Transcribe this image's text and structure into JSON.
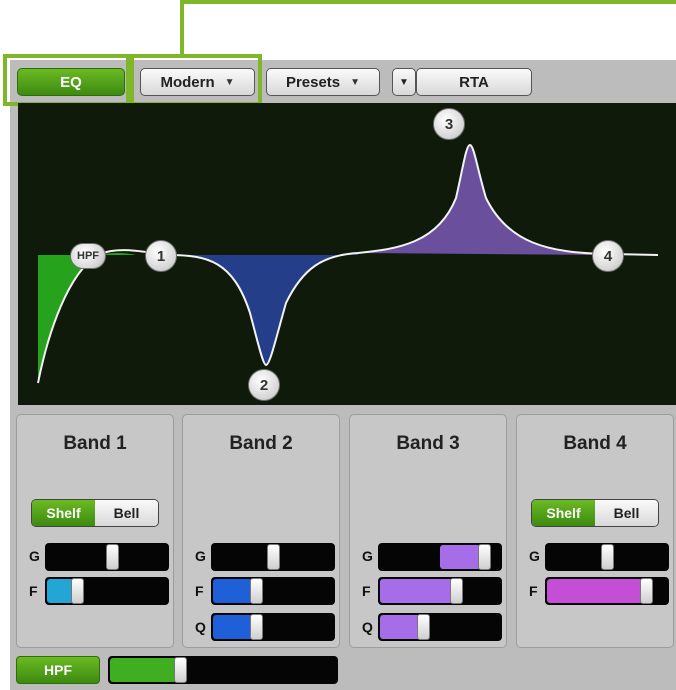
{
  "toolbar": {
    "eq_label": "EQ",
    "mode_label": "Modern",
    "presets_label": "Presets",
    "rta_label": "RTA"
  },
  "graph": {
    "nodes": {
      "hpf": "HPF",
      "n1": "1",
      "n2": "2",
      "n3": "3",
      "n4": "4"
    },
    "colors": {
      "hpf_fill": "#26a21c",
      "band2_fill": "#243e8a",
      "band3_fill": "#6a4f9c",
      "background": "#0f1a0b"
    }
  },
  "bands": [
    {
      "title": "Band 1",
      "shelf_label": "Shelf",
      "bell_label": "Bell",
      "mode": "Shelf",
      "g_label": "G",
      "f_label": "F",
      "g_level": 0.55,
      "f_level": 0.22,
      "accent": "#22a6d6"
    },
    {
      "title": "Band 2",
      "g_label": "G",
      "f_label": "F",
      "q_label": "Q",
      "g_level": 0.5,
      "f_level": 0.35,
      "q_level": 0.35,
      "accent": "#1f5fd8"
    },
    {
      "title": "Band 3",
      "g_label": "G",
      "f_label": "F",
      "q_label": "Q",
      "g_level": 0.92,
      "f_level": 0.65,
      "q_level": 0.35,
      "accent": "#a56ee8"
    },
    {
      "title": "Band 4",
      "shelf_label": "Shelf",
      "bell_label": "Bell",
      "mode": "Shelf",
      "g_label": "G",
      "f_label": "F",
      "g_level": 0.5,
      "f_level": 0.87,
      "accent": "#c44ed6"
    }
  ],
  "hpf": {
    "label": "HPF",
    "level": 0.3,
    "accent": "#3fae20"
  }
}
